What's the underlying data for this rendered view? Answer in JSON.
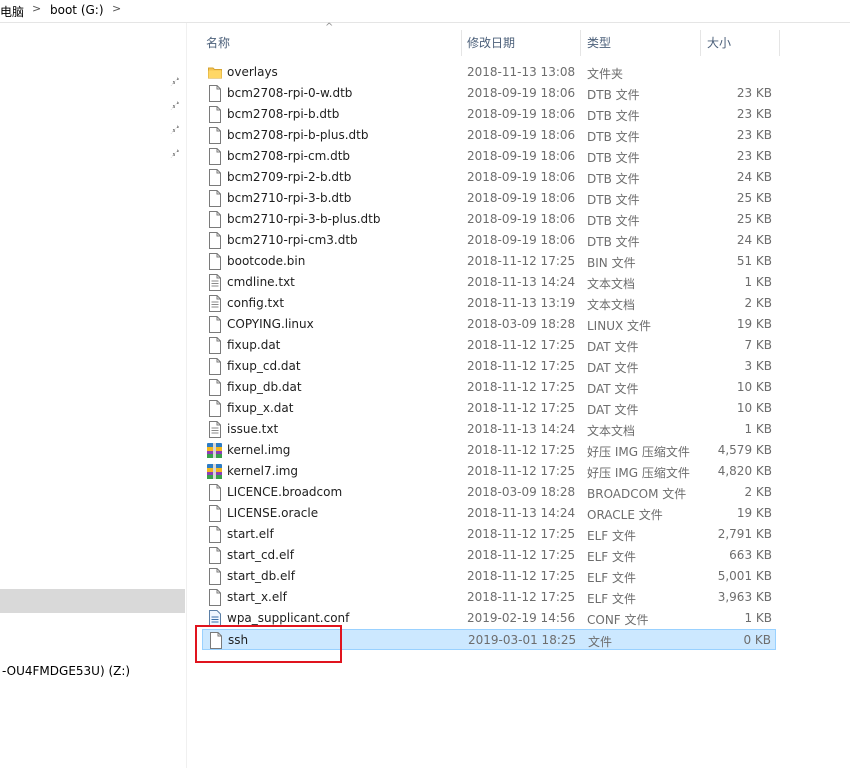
{
  "breadcrumb": {
    "parent": "电脑",
    "current": "boot (G:)"
  },
  "nav": {
    "drive_label": "-OU4FMDGE53U) (Z:)"
  },
  "columns": {
    "name": "名称",
    "date": "修改日期",
    "type": "类型",
    "size": "大小"
  },
  "files": [
    {
      "name": "overlays",
      "date": "2018-11-13 13:08",
      "type": "文件夹",
      "size": "",
      "icon": "folder-icon"
    },
    {
      "name": "bcm2708-rpi-0-w.dtb",
      "date": "2018-09-19 18:06",
      "type": "DTB 文件",
      "size": "23 KB",
      "icon": "file-icon"
    },
    {
      "name": "bcm2708-rpi-b.dtb",
      "date": "2018-09-19 18:06",
      "type": "DTB 文件",
      "size": "23 KB",
      "icon": "file-icon"
    },
    {
      "name": "bcm2708-rpi-b-plus.dtb",
      "date": "2018-09-19 18:06",
      "type": "DTB 文件",
      "size": "23 KB",
      "icon": "file-icon"
    },
    {
      "name": "bcm2708-rpi-cm.dtb",
      "date": "2018-09-19 18:06",
      "type": "DTB 文件",
      "size": "23 KB",
      "icon": "file-icon"
    },
    {
      "name": "bcm2709-rpi-2-b.dtb",
      "date": "2018-09-19 18:06",
      "type": "DTB 文件",
      "size": "24 KB",
      "icon": "file-icon"
    },
    {
      "name": "bcm2710-rpi-3-b.dtb",
      "date": "2018-09-19 18:06",
      "type": "DTB 文件",
      "size": "25 KB",
      "icon": "file-icon"
    },
    {
      "name": "bcm2710-rpi-3-b-plus.dtb",
      "date": "2018-09-19 18:06",
      "type": "DTB 文件",
      "size": "25 KB",
      "icon": "file-icon"
    },
    {
      "name": "bcm2710-rpi-cm3.dtb",
      "date": "2018-09-19 18:06",
      "type": "DTB 文件",
      "size": "24 KB",
      "icon": "file-icon"
    },
    {
      "name": "bootcode.bin",
      "date": "2018-11-12 17:25",
      "type": "BIN 文件",
      "size": "51 KB",
      "icon": "file-icon"
    },
    {
      "name": "cmdline.txt",
      "date": "2018-11-13 14:24",
      "type": "文本文档",
      "size": "1 KB",
      "icon": "text-file-icon"
    },
    {
      "name": "config.txt",
      "date": "2018-11-13 13:19",
      "type": "文本文档",
      "size": "2 KB",
      "icon": "text-file-icon"
    },
    {
      "name": "COPYING.linux",
      "date": "2018-03-09 18:28",
      "type": "LINUX 文件",
      "size": "19 KB",
      "icon": "file-icon"
    },
    {
      "name": "fixup.dat",
      "date": "2018-11-12 17:25",
      "type": "DAT 文件",
      "size": "7 KB",
      "icon": "file-icon"
    },
    {
      "name": "fixup_cd.dat",
      "date": "2018-11-12 17:25",
      "type": "DAT 文件",
      "size": "3 KB",
      "icon": "file-icon"
    },
    {
      "name": "fixup_db.dat",
      "date": "2018-11-12 17:25",
      "type": "DAT 文件",
      "size": "10 KB",
      "icon": "file-icon"
    },
    {
      "name": "fixup_x.dat",
      "date": "2018-11-12 17:25",
      "type": "DAT 文件",
      "size": "10 KB",
      "icon": "file-icon"
    },
    {
      "name": "issue.txt",
      "date": "2018-11-13 14:24",
      "type": "文本文档",
      "size": "1 KB",
      "icon": "text-file-icon"
    },
    {
      "name": "kernel.img",
      "date": "2018-11-12 17:25",
      "type": "好压 IMG 压缩文件",
      "size": "4,579 KB",
      "icon": "archive-icon"
    },
    {
      "name": "kernel7.img",
      "date": "2018-11-12 17:25",
      "type": "好压 IMG 压缩文件",
      "size": "4,820 KB",
      "icon": "archive-icon"
    },
    {
      "name": "LICENCE.broadcom",
      "date": "2018-03-09 18:28",
      "type": "BROADCOM 文件",
      "size": "2 KB",
      "icon": "file-icon"
    },
    {
      "name": "LICENSE.oracle",
      "date": "2018-11-13 14:24",
      "type": "ORACLE 文件",
      "size": "19 KB",
      "icon": "file-icon"
    },
    {
      "name": "start.elf",
      "date": "2018-11-12 17:25",
      "type": "ELF 文件",
      "size": "2,791 KB",
      "icon": "file-icon"
    },
    {
      "name": "start_cd.elf",
      "date": "2018-11-12 17:25",
      "type": "ELF 文件",
      "size": "663 KB",
      "icon": "file-icon"
    },
    {
      "name": "start_db.elf",
      "date": "2018-11-12 17:25",
      "type": "ELF 文件",
      "size": "5,001 KB",
      "icon": "file-icon"
    },
    {
      "name": "start_x.elf",
      "date": "2018-11-12 17:25",
      "type": "ELF 文件",
      "size": "3,963 KB",
      "icon": "file-icon"
    },
    {
      "name": "wpa_supplicant.conf",
      "date": "2019-02-19 14:56",
      "type": "CONF 文件",
      "size": "1 KB",
      "icon": "config-file-icon"
    },
    {
      "name": "ssh",
      "date": "2019-03-01 18:25",
      "type": "文件",
      "size": "0 KB",
      "icon": "file-icon",
      "selected": true
    }
  ],
  "colors": {
    "selection_bg": "#cce8ff",
    "selection_border": "#99d1ff",
    "highlight_box": "#e0141e",
    "header_text": "#4c607a"
  }
}
